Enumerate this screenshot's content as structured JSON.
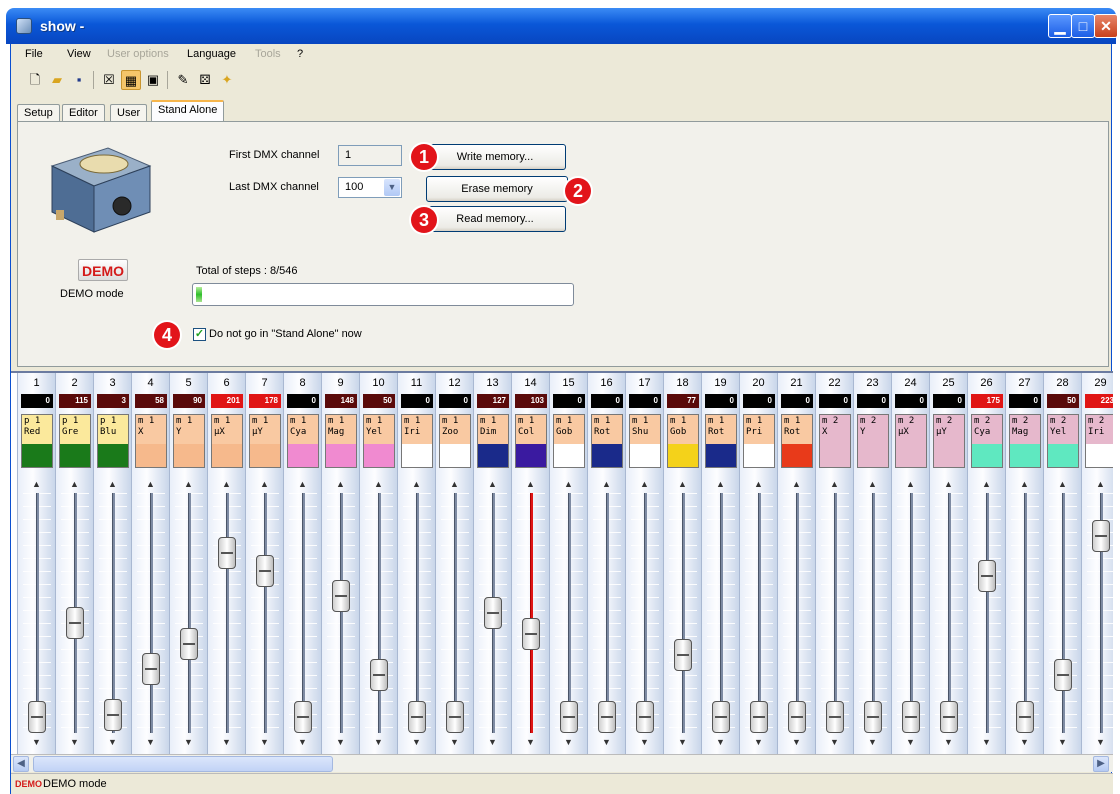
{
  "window": {
    "title": "show -",
    "minimize": "▁",
    "maximize": "□",
    "close": "✕"
  },
  "menu": [
    {
      "label": "File",
      "enabled": true
    },
    {
      "label": "View",
      "enabled": true
    },
    {
      "label": "User options",
      "enabled": false
    },
    {
      "label": "Language",
      "enabled": true
    },
    {
      "label": "Tools",
      "enabled": false
    },
    {
      "label": "?",
      "enabled": true
    }
  ],
  "toolbar": [
    "new-icon",
    "open-icon",
    "save-icon",
    "x-icon",
    "grid-icon",
    "window-icon",
    "wrench-icon",
    "dice-icon",
    "help-icon"
  ],
  "tabs": [
    {
      "label": "Setup",
      "active": false
    },
    {
      "label": "Editor",
      "active": false
    },
    {
      "label": "User",
      "active": false
    },
    {
      "label": "Stand Alone",
      "active": true
    }
  ],
  "standalone": {
    "first_dmx_label": "First DMX channel",
    "first_dmx_value": "1",
    "last_dmx_label": "Last DMX channel",
    "last_dmx_value": "100",
    "write_button": "Write memory...",
    "erase_button": "Erase memory",
    "read_button": "Read memory...",
    "steps_text": "Total of steps : 8/546",
    "progress_fraction": 0.015,
    "checkbox_label": "Do not go in \"Stand Alone\" now",
    "checkbox_checked": true,
    "demo_badge": "DEMO",
    "demo_mode_label": "DEMO mode",
    "badges": [
      "1",
      "2",
      "3",
      "4"
    ]
  },
  "channels": [
    {
      "num": "1",
      "value": "0",
      "l1": "p 1",
      "l2": "Red",
      "swatch": "#1a7a1a",
      "level": 0.0
    },
    {
      "num": "2",
      "value": "115",
      "l1": "p 1",
      "l2": "Gre",
      "swatch": "#1a7a1a",
      "level": 0.45
    },
    {
      "num": "3",
      "value": "3",
      "l1": "p 1",
      "l2": "Blu",
      "swatch": "#1a7a1a",
      "level": 0.01
    },
    {
      "num": "4",
      "value": "58",
      "l1": "m 1",
      "l2": "X",
      "swatch": "#f6b98c",
      "level": 0.23
    },
    {
      "num": "5",
      "value": "90",
      "l1": "m 1",
      "l2": "Y",
      "swatch": "#f6b98c",
      "level": 0.35
    },
    {
      "num": "6",
      "value": "201",
      "l1": "m 1",
      "l2": "µX",
      "swatch": "#f6b98c",
      "level": 0.79
    },
    {
      "num": "7",
      "value": "178",
      "l1": "m 1",
      "l2": "µY",
      "swatch": "#f6b98c",
      "level": 0.7
    },
    {
      "num": "8",
      "value": "0",
      "l1": "m 1",
      "l2": "Cya",
      "swatch": "#f08ad0",
      "level": 0.0
    },
    {
      "num": "9",
      "value": "148",
      "l1": "m 1",
      "l2": "Mag",
      "swatch": "#f08ad0",
      "level": 0.58
    },
    {
      "num": "10",
      "value": "50",
      "l1": "m 1",
      "l2": "Yel",
      "swatch": "#f08ad0",
      "level": 0.2
    },
    {
      "num": "11",
      "value": "0",
      "l1": "m 1",
      "l2": "Iri",
      "swatch": "#ffffff",
      "level": 0.0
    },
    {
      "num": "12",
      "value": "0",
      "l1": "m 1",
      "l2": "Zoo",
      "swatch": "#ffffff",
      "level": 0.0
    },
    {
      "num": "13",
      "value": "127",
      "l1": "m 1",
      "l2": "Dim",
      "swatch": "#1a2a8a",
      "level": 0.5
    },
    {
      "num": "14",
      "value": "103",
      "l1": "m 1",
      "l2": "Col",
      "swatch": "#3a1aa0",
      "level": 0.4
    },
    {
      "num": "15",
      "value": "0",
      "l1": "m 1",
      "l2": "Gob",
      "swatch": "#ffffff",
      "level": 0.0
    },
    {
      "num": "16",
      "value": "0",
      "l1": "m 1",
      "l2": "Rot",
      "swatch": "#1a2a8a",
      "level": 0.0
    },
    {
      "num": "17",
      "value": "0",
      "l1": "m 1",
      "l2": "Shu",
      "swatch": "#ffffff",
      "level": 0.0
    },
    {
      "num": "18",
      "value": "77",
      "l1": "m 1",
      "l2": "Gob",
      "swatch": "#f4d21a",
      "level": 0.3
    },
    {
      "num": "19",
      "value": "0",
      "l1": "m 1",
      "l2": "Rot",
      "swatch": "#1a2a8a",
      "level": 0.0
    },
    {
      "num": "20",
      "value": "0",
      "l1": "m 1",
      "l2": "Pri",
      "swatch": "#ffffff",
      "level": 0.0
    },
    {
      "num": "21",
      "value": "0",
      "l1": "m 1",
      "l2": "Rot",
      "swatch": "#e83a1a",
      "level": 0.0
    },
    {
      "num": "22",
      "value": "0",
      "l1": "m 2",
      "l2": "X",
      "swatch": "#e6b8cc",
      "level": 0.0
    },
    {
      "num": "23",
      "value": "0",
      "l1": "m 2",
      "l2": "Y",
      "swatch": "#e6b8cc",
      "level": 0.0
    },
    {
      "num": "24",
      "value": "0",
      "l1": "m 2",
      "l2": "µX",
      "swatch": "#e6b8cc",
      "level": 0.0
    },
    {
      "num": "25",
      "value": "0",
      "l1": "m 2",
      "l2": "µY",
      "swatch": "#e6b8cc",
      "level": 0.0
    },
    {
      "num": "26",
      "value": "175",
      "l1": "m 2",
      "l2": "Cya",
      "swatch": "#5fe8c0",
      "level": 0.68
    },
    {
      "num": "27",
      "value": "0",
      "l1": "m 2",
      "l2": "Mag",
      "swatch": "#5fe8c0",
      "level": 0.0
    },
    {
      "num": "28",
      "value": "50",
      "l1": "m 2",
      "l2": "Yel",
      "swatch": "#5fe8c0",
      "level": 0.2
    },
    {
      "num": "29",
      "value": "223",
      "l1": "m 2",
      "l2": "Iri",
      "swatch": "#ffffff",
      "level": 0.87
    }
  ],
  "status": {
    "badge": "DEMO",
    "text": "DEMO mode"
  }
}
